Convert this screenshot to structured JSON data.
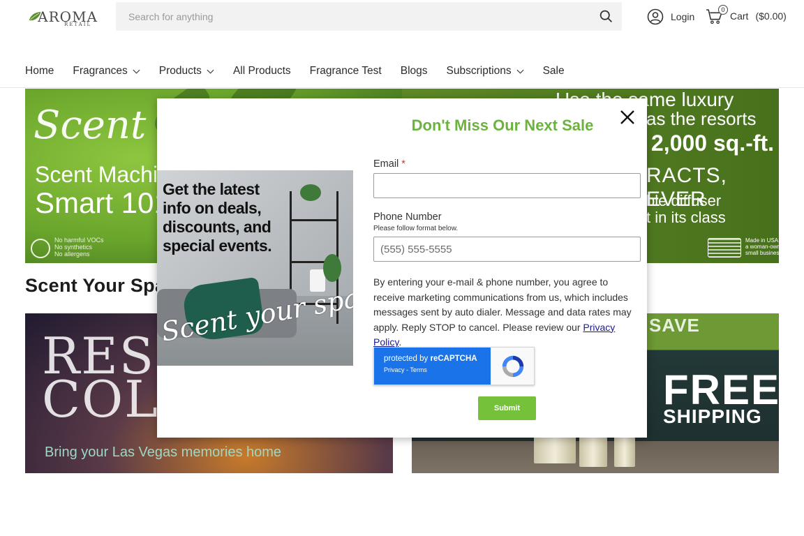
{
  "header": {
    "logo_main": "AROMA",
    "logo_sub": "RETAIL",
    "search_placeholder": "Search for anything",
    "login_label": "Login",
    "cart_label": "Cart",
    "cart_total": "($0.00)",
    "cart_count": "0"
  },
  "nav": [
    {
      "label": "Home",
      "has_dropdown": false
    },
    {
      "label": "Fragrances",
      "has_dropdown": true
    },
    {
      "label": "Products",
      "has_dropdown": true
    },
    {
      "label": "All Products",
      "has_dropdown": false
    },
    {
      "label": "Fragrance Test",
      "has_dropdown": false
    },
    {
      "label": "Blogs",
      "has_dropdown": false
    },
    {
      "label": "Subscriptions",
      "has_dropdown": true
    },
    {
      "label": "Sale",
      "has_dropdown": false
    }
  ],
  "hero": {
    "script_text": "Scent your",
    "line1": "Scent Machin",
    "line2": "Smart 101",
    "left_footer": "No harmful VOCs\nNo synthetics\nNo allergens",
    "right_line1": "Use the same luxury",
    "right_line2": "as the resorts",
    "right_line3": "2,000 sq.-ft.",
    "right_line4": "RACTS, EVER",
    "right_line5": "ble diffuser",
    "right_line6": "t in its class",
    "right_footer": "Made in USA by\na woman-owned\nsmall business"
  },
  "section_title": "Scent Your Spac",
  "cards": {
    "resort_big": "RESO\nCOLL",
    "resort_sub": "Bring your Las Vegas memories home",
    "ship_save": "SAVE",
    "ship_free": "FREE",
    "ship_shipping": "SHIPPING"
  },
  "modal": {
    "title": "Don't Miss Our Next Sale",
    "promo_text": "Get the latest info on deals, discounts, and special events.",
    "promo_script": "Scent your space!",
    "email_label": "Email",
    "email_required": "*",
    "email_value": "",
    "phone_label": "Phone Number",
    "phone_hint": "Please follow format below.",
    "phone_placeholder": "(555) 555-5555",
    "consent_text": "By entering your e-mail & phone number, you agree to receive marketing communications from us, which includes messages sent by auto dialer. Message and data rates may apply. Reply STOP to cancel. Please review our ",
    "privacy_link": "Privacy Policy",
    "consent_end": ".",
    "recaptcha_prefix": "protected by ",
    "recaptcha_brand": "reCAPTCHA",
    "recaptcha_sub": "Privacy - Terms",
    "submit_label": "Submit"
  },
  "colors": {
    "accent_green": "#6cb33e",
    "submit_green": "#75c23a",
    "recaptcha_blue": "#1a73e8",
    "required_red": "#d9342b"
  }
}
